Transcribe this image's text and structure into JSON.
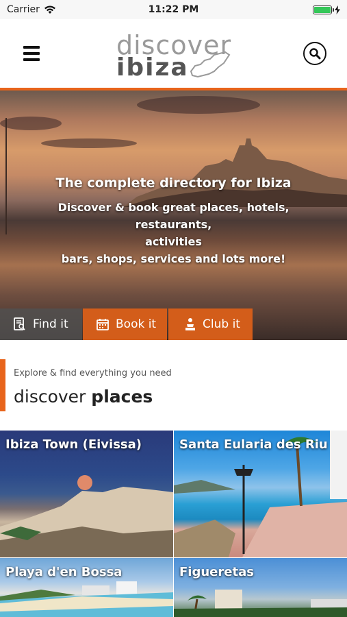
{
  "status_bar": {
    "carrier": "Carrier",
    "time": "11:22 PM",
    "battery_level": 1.0
  },
  "header": {
    "logo_line1": "discover",
    "logo_line2": "ibiza",
    "menu_icon": "hamburger-icon",
    "search_icon": "search-icon"
  },
  "hero": {
    "title": "The complete directory for Ibiza",
    "subtitle_line1": "Discover & book great places, hotels, restaurants,",
    "subtitle_line2": "activities",
    "subtitle_line3": "bars, shops, services and lots more!",
    "tabs": [
      {
        "label": "Find it",
        "icon": "directory-icon"
      },
      {
        "label": "Book it",
        "icon": "calendar-icon"
      },
      {
        "label": "Club it",
        "icon": "dj-icon"
      }
    ]
  },
  "discover": {
    "subtitle": "Explore & find everything you need",
    "title_light": "discover",
    "title_bold": "places"
  },
  "places": [
    {
      "name": "Ibiza Town (Eivissa)"
    },
    {
      "name": "Santa Eularia des Riu"
    },
    {
      "name": "Playa d'en Bossa"
    },
    {
      "name": "Figueretas"
    }
  ],
  "colors": {
    "accent": "#e8641b",
    "tab_orange": "#d35d1a",
    "tab_gray": "#505050"
  }
}
